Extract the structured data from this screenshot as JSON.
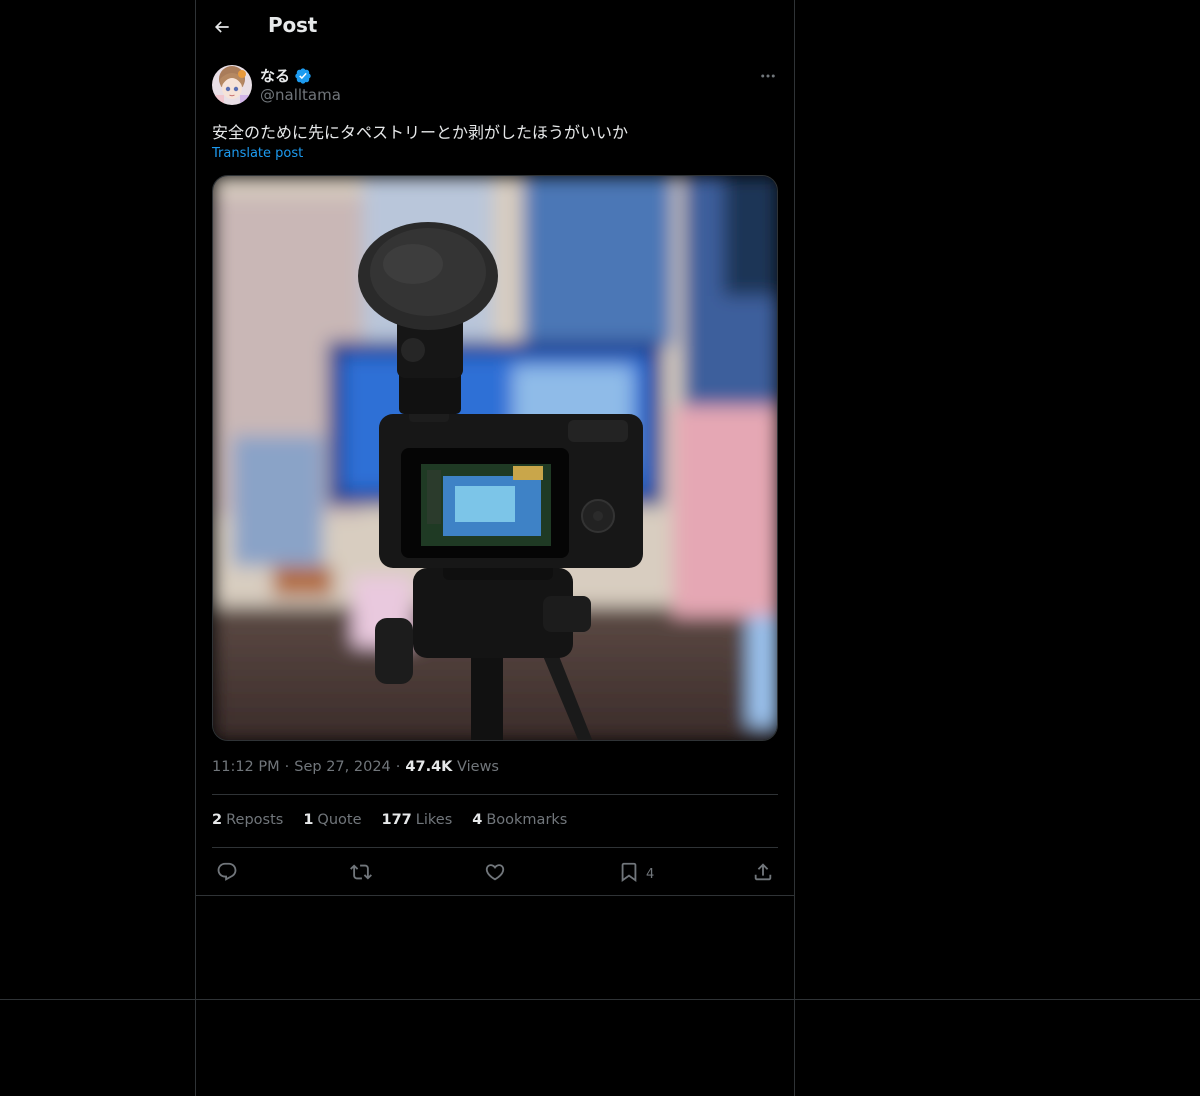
{
  "header": {
    "title": "Post"
  },
  "author": {
    "display_name": "なる",
    "handle": "@nalltama"
  },
  "tweet": {
    "text": "安全のために先にタペストリーとか剥がしたほうがいいか",
    "translate_label": "Translate post"
  },
  "meta": {
    "time": "11:12 PM",
    "date": "Sep 27, 2024",
    "views_count": "47.4K",
    "views_label": "Views"
  },
  "stats": {
    "reposts_count": "2",
    "reposts_label": "Reposts",
    "quotes_count": "1",
    "quotes_label": "Quote",
    "likes_count": "177",
    "likes_label": "Likes",
    "bookmarks_count": "4",
    "bookmarks_label": "Bookmarks"
  },
  "actions": {
    "bookmark_count": "4"
  },
  "colors": {
    "accent": "#1d9bf0",
    "background": "#000000",
    "border": "#2f3336",
    "muted": "#71767b"
  }
}
